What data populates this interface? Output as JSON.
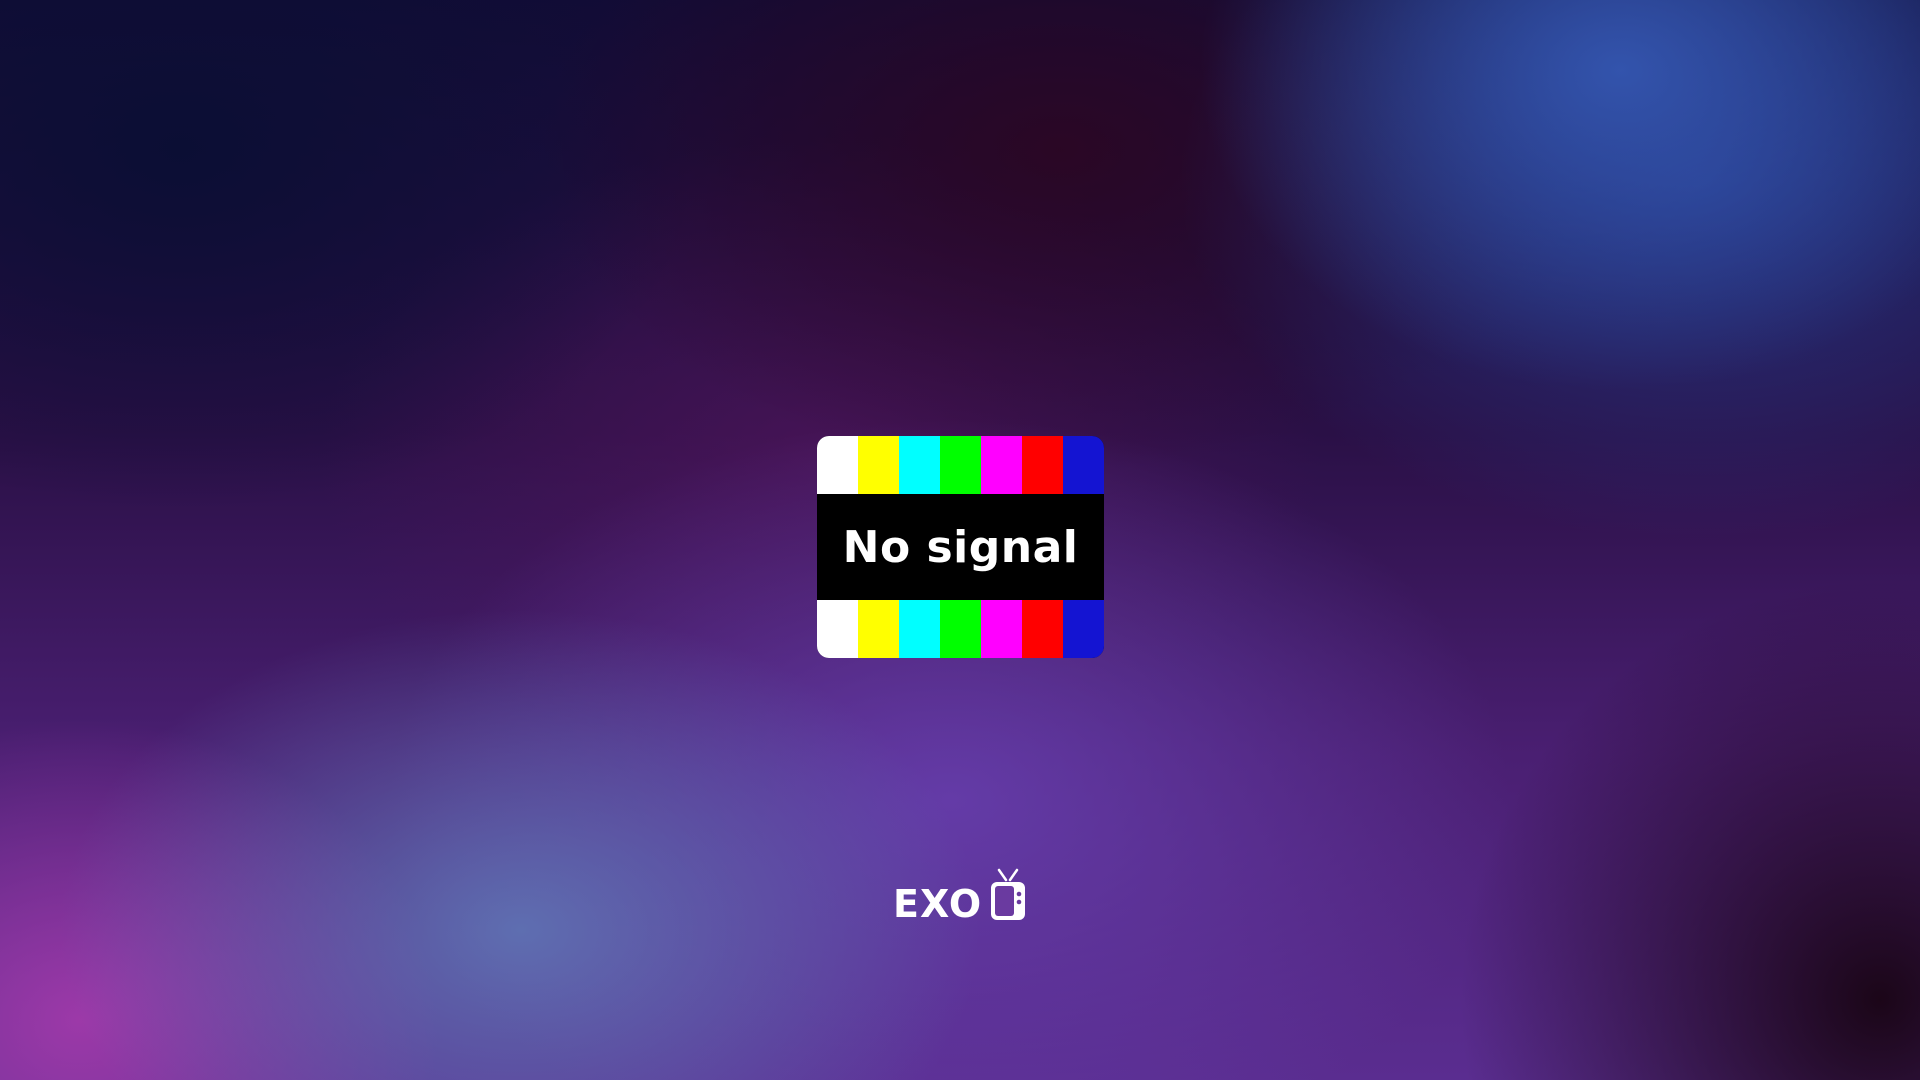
{
  "screen": {
    "message": "No signal"
  },
  "test_pattern": {
    "bar_colors": [
      "#ffffff",
      "#ffff00",
      "#00ffff",
      "#00ff00",
      "#ff00ff",
      "#ff0000",
      "#1414d2"
    ]
  },
  "logo": {
    "text": "EXO",
    "icon": "tv-icon"
  }
}
